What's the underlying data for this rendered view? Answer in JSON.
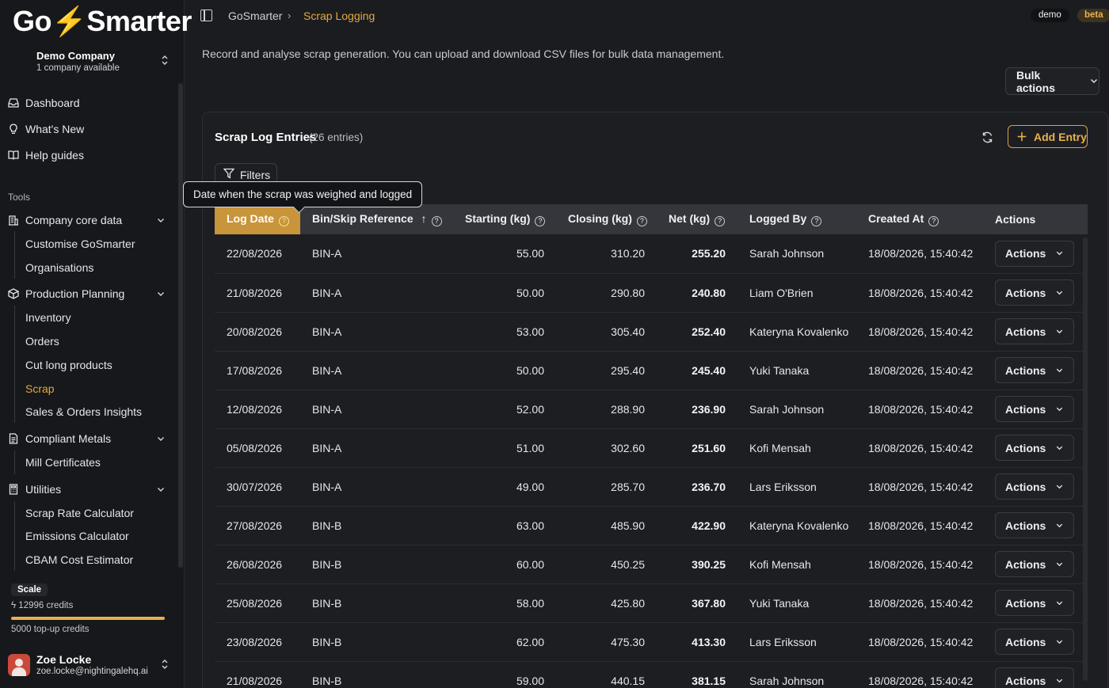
{
  "sidebar": {
    "logo": {
      "pre": "Go",
      "bolt": "⚡",
      "post": "Smarter"
    },
    "company": {
      "name": "Demo Company",
      "sub": "1 company available"
    },
    "nav": [
      {
        "label": "Dashboard",
        "icon": "inbox-icon"
      },
      {
        "label": "What's New",
        "icon": "lightbulb-icon"
      },
      {
        "label": "Help guides",
        "icon": "book-icon"
      }
    ],
    "tools_label": "Tools",
    "groups": [
      {
        "label": "Company core data",
        "icon": "building-icon",
        "items": [
          "Customise GoSmarter",
          "Organisations"
        ]
      },
      {
        "label": "Production Planning",
        "icon": "box-icon",
        "items": [
          "Inventory",
          "Orders",
          "Cut long products",
          "Scrap",
          "Sales & Orders Insights"
        ]
      },
      {
        "label": "Compliant Metals",
        "icon": "document-icon",
        "items": [
          "Mill Certificates"
        ]
      },
      {
        "label": "Utilities",
        "icon": "calculator-icon",
        "items": [
          "Scrap Rate Calculator",
          "Emissions Calculator",
          "CBAM Cost Estimator"
        ]
      }
    ],
    "active_item": "Scrap",
    "plan": "Scale",
    "credits": "12996 credits",
    "credits_fill_fraction": 0.97,
    "topup": "5000 top-up credits",
    "user": {
      "name": "Zoe Locke",
      "email": "zoe.locke@nightingalehq.ai"
    }
  },
  "header": {
    "breadcrumb_root": "GoSmarter",
    "breadcrumb_sep": "›",
    "breadcrumb_current": "Scrap Logging",
    "badge_demo": "demo",
    "badge_beta": "beta"
  },
  "main": {
    "description": "Record and analyse scrap generation. You can upload and download CSV files for bulk data management.",
    "bulk_actions": "Bulk actions",
    "card_title": "Scrap Log Entries",
    "card_count": "(26 entries)",
    "add_entry": "Add Entry",
    "filters": "Filters",
    "tooltip": "Date when the scrap was weighed and logged",
    "columns": [
      "Log Date",
      "Bin/Skip Reference",
      "Starting (kg)",
      "Closing (kg)",
      "Net (kg)",
      "Logged By",
      "Created At",
      "Actions"
    ],
    "sort_indicator": "↑",
    "action_label": "Actions",
    "rows": [
      {
        "date": "22/08/2026",
        "bin": "BIN-A",
        "start": "55.00",
        "close": "310.20",
        "net": "255.20",
        "by": "Sarah Johnson",
        "created": "18/08/2026, 15:40:42"
      },
      {
        "date": "21/08/2026",
        "bin": "BIN-A",
        "start": "50.00",
        "close": "290.80",
        "net": "240.80",
        "by": "Liam O'Brien",
        "created": "18/08/2026, 15:40:42"
      },
      {
        "date": "20/08/2026",
        "bin": "BIN-A",
        "start": "53.00",
        "close": "305.40",
        "net": "252.40",
        "by": "Kateryna Kovalenko",
        "created": "18/08/2026, 15:40:42"
      },
      {
        "date": "17/08/2026",
        "bin": "BIN-A",
        "start": "50.00",
        "close": "295.40",
        "net": "245.40",
        "by": "Yuki Tanaka",
        "created": "18/08/2026, 15:40:42"
      },
      {
        "date": "12/08/2026",
        "bin": "BIN-A",
        "start": "52.00",
        "close": "288.90",
        "net": "236.90",
        "by": "Sarah Johnson",
        "created": "18/08/2026, 15:40:42"
      },
      {
        "date": "05/08/2026",
        "bin": "BIN-A",
        "start": "51.00",
        "close": "302.60",
        "net": "251.60",
        "by": "Kofi Mensah",
        "created": "18/08/2026, 15:40:42"
      },
      {
        "date": "30/07/2026",
        "bin": "BIN-A",
        "start": "49.00",
        "close": "285.70",
        "net": "236.70",
        "by": "Lars Eriksson",
        "created": "18/08/2026, 15:40:42"
      },
      {
        "date": "27/08/2026",
        "bin": "BIN-B",
        "start": "63.00",
        "close": "485.90",
        "net": "422.90",
        "by": "Kateryna Kovalenko",
        "created": "18/08/2026, 15:40:42"
      },
      {
        "date": "26/08/2026",
        "bin": "BIN-B",
        "start": "60.00",
        "close": "450.25",
        "net": "390.25",
        "by": "Kofi Mensah",
        "created": "18/08/2026, 15:40:42"
      },
      {
        "date": "25/08/2026",
        "bin": "BIN-B",
        "start": "58.00",
        "close": "425.80",
        "net": "367.80",
        "by": "Yuki Tanaka",
        "created": "18/08/2026, 15:40:42"
      },
      {
        "date": "23/08/2026",
        "bin": "BIN-B",
        "start": "62.00",
        "close": "475.30",
        "net": "413.30",
        "by": "Lars Eriksson",
        "created": "18/08/2026, 15:40:42"
      },
      {
        "date": "21/08/2026",
        "bin": "BIN-B",
        "start": "59.00",
        "close": "440.15",
        "net": "381.15",
        "by": "Sarah Johnson",
        "created": "18/08/2026, 15:40:42"
      }
    ]
  },
  "colors": {
    "accent": "#e3aa3e",
    "sorted_header": "#c8953a",
    "background": "#1b1c20"
  }
}
